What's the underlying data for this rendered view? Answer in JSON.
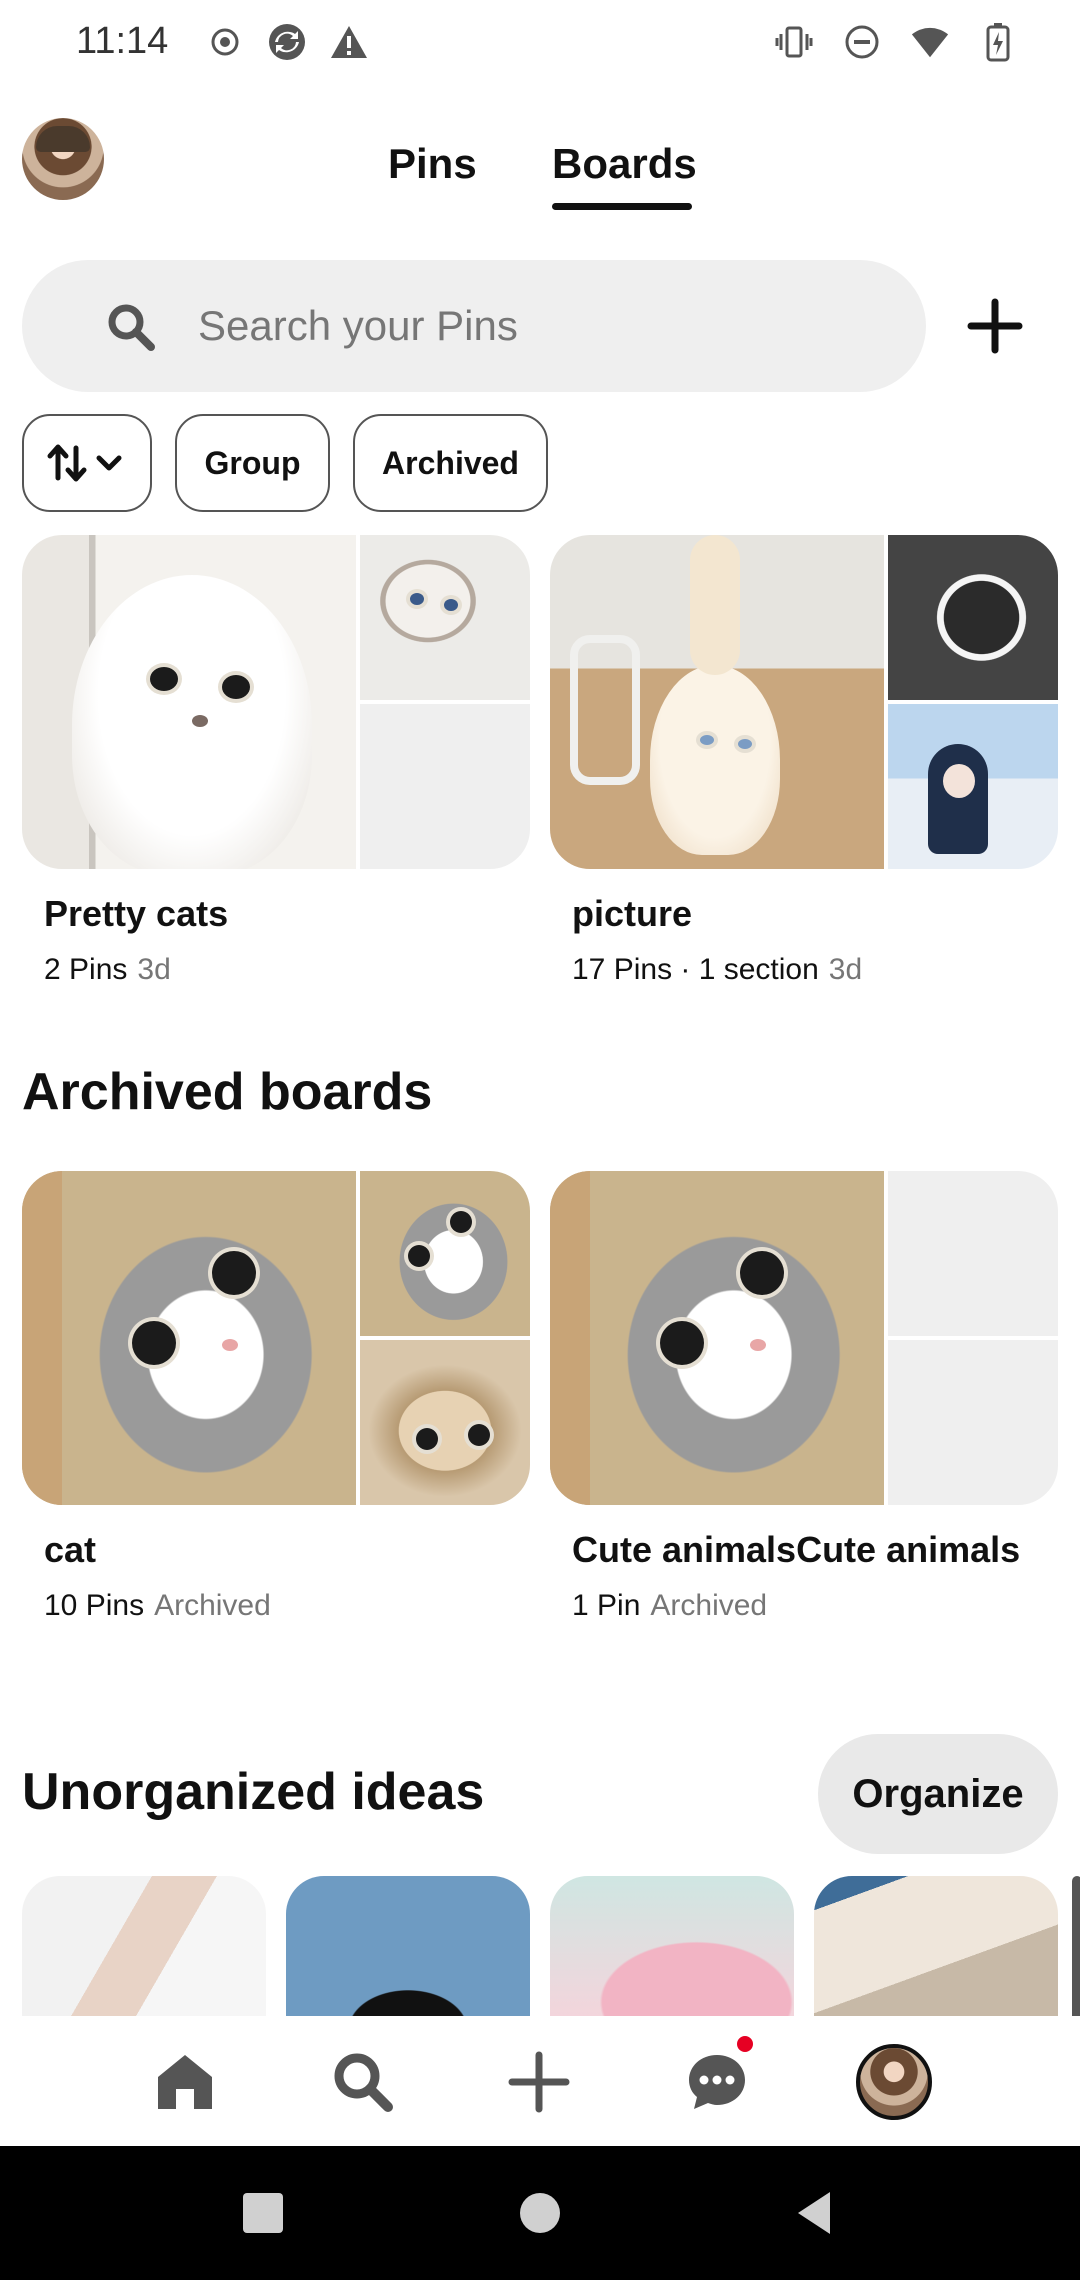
{
  "status_bar": {
    "time": "11:14"
  },
  "header": {
    "tabs": [
      {
        "label": "Pins"
      },
      {
        "label": "Boards"
      }
    ],
    "active_tab": "Boards"
  },
  "search": {
    "placeholder": "Search your Pins"
  },
  "filters": {
    "group_label": "Group",
    "archived_label": "Archived"
  },
  "boards": [
    {
      "title": "Pretty cats",
      "count": "2 Pins",
      "extra": "",
      "time": "3d"
    },
    {
      "title": "picture",
      "count": "17 Pins · 1 section",
      "extra": "",
      "time": "3d"
    }
  ],
  "archived_section": {
    "title": "Archived boards",
    "boards": [
      {
        "title": "cat",
        "count": "10 Pins",
        "status": "Archived"
      },
      {
        "title": "Cute animalsCute animals",
        "count": "1 Pin",
        "status": "Archived"
      }
    ]
  },
  "unorganized": {
    "title": "Unorganized ideas",
    "organize_label": "Organize"
  },
  "bottom_nav": {
    "items": [
      "home-icon",
      "search-icon",
      "plus-icon",
      "chat-icon",
      "profile-avatar"
    ],
    "notification_color": "#e60023"
  },
  "colors": {
    "accent": "#111111",
    "chip_bg": "#efefef",
    "muted_text": "#767676"
  }
}
